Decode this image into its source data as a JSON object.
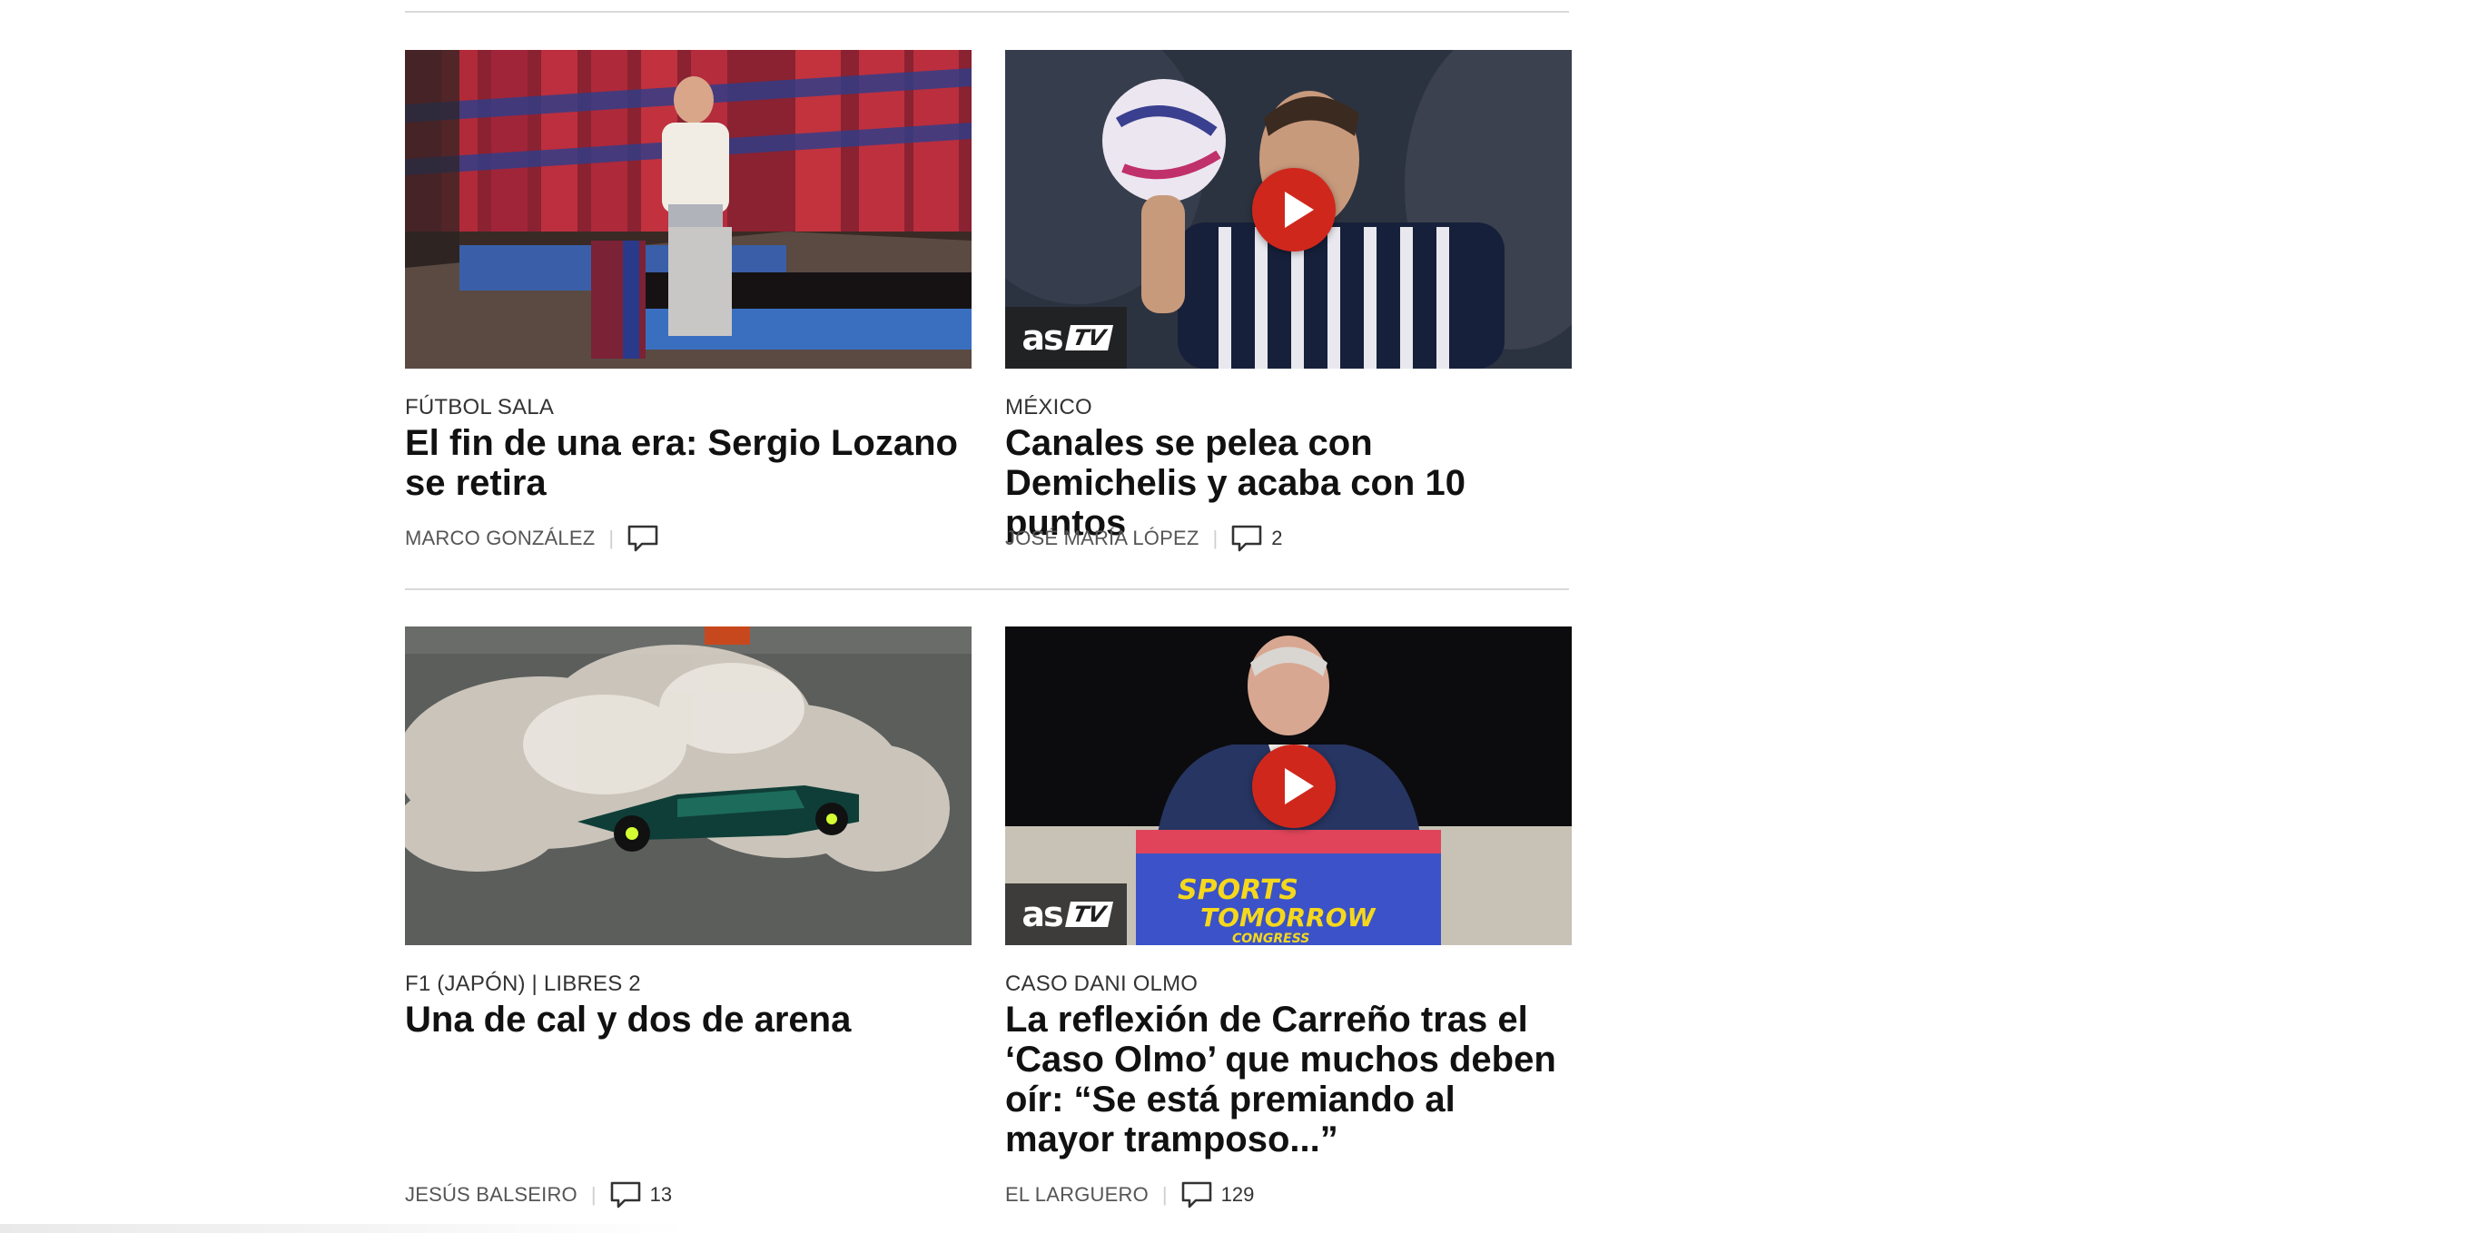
{
  "articles": [
    {
      "kicker": "FÚTBOL SALA",
      "headline": "El fin de una era: Sergio Lozano se retira",
      "author": "MARCO GONZÁLEZ",
      "comments": "",
      "is_video": false
    },
    {
      "kicker": "MÉXICO",
      "headline": "Canales se pelea con Demichelis y acaba con 10 puntos",
      "author": "JOSÉ MARÍA LÓPEZ",
      "comments": "2",
      "is_video": true,
      "video_badge": {
        "as": "as",
        "tv": "TV"
      }
    },
    {
      "kicker": "F1 (JAPÓN) | LIBRES 2",
      "headline": "Una de cal y dos de arena",
      "author": "JESÚS BALSEIRO",
      "comments": "13",
      "is_video": false
    },
    {
      "kicker": "CASO DANI OLMO",
      "headline": "La reflexión de Carreño tras el ‘Caso Olmo’ que muchos deben oír: “Se está premiando al mayor tramposo...”",
      "author": "EL LARGUERO",
      "comments": "129",
      "is_video": true,
      "video_badge": {
        "as": "as",
        "tv": "TV"
      },
      "image_banner": {
        "line1": "SPORTS",
        "line2": "TOMORROW",
        "line3": "CONGRESS"
      }
    }
  ],
  "separator": "|",
  "colors": {
    "play_button": "#d0271d",
    "rule": "#d9d9d9",
    "headline": "#111111",
    "meta": "#555555"
  },
  "icons": {
    "comment": "comment-bubble-icon",
    "play": "play-icon"
  }
}
